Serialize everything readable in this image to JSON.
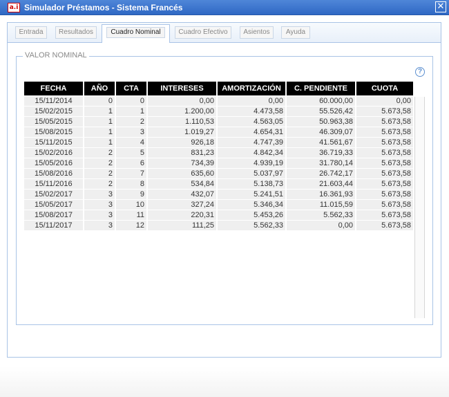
{
  "window": {
    "title": "Simulador Préstamos - Sistema Francés",
    "app_icon_text": "a.i",
    "close_glyph": "✕"
  },
  "tabs": [
    {
      "label": "Entrada"
    },
    {
      "label": "Resultados"
    },
    {
      "label": "Cuadro Nominal"
    },
    {
      "label": "Cuadro Efectivo"
    },
    {
      "label": "Asientos"
    },
    {
      "label": "Ayuda"
    }
  ],
  "active_tab": "Cuadro Nominal",
  "section": {
    "legend": "VALOR NOMINAL",
    "help_glyph": "?"
  },
  "table": {
    "headers": [
      "FECHA",
      "AÑO",
      "CTA",
      "INTERESES",
      "AMORTIZACIÓN",
      "C. PENDIENTE",
      "CUOTA"
    ],
    "rows": [
      [
        "15/11/2014",
        "0",
        "0",
        "0,00",
        "0,00",
        "60.000,00",
        "0,00"
      ],
      [
        "15/02/2015",
        "1",
        "1",
        "1.200,00",
        "4.473,58",
        "55.526,42",
        "5.673,58"
      ],
      [
        "15/05/2015",
        "1",
        "2",
        "1.110,53",
        "4.563,05",
        "50.963,38",
        "5.673,58"
      ],
      [
        "15/08/2015",
        "1",
        "3",
        "1.019,27",
        "4.654,31",
        "46.309,07",
        "5.673,58"
      ],
      [
        "15/11/2015",
        "1",
        "4",
        "926,18",
        "4.747,39",
        "41.561,67",
        "5.673,58"
      ],
      [
        "15/02/2016",
        "2",
        "5",
        "831,23",
        "4.842,34",
        "36.719,33",
        "5.673,58"
      ],
      [
        "15/05/2016",
        "2",
        "6",
        "734,39",
        "4.939,19",
        "31.780,14",
        "5.673,58"
      ],
      [
        "15/08/2016",
        "2",
        "7",
        "635,60",
        "5.037,97",
        "26.742,17",
        "5.673,58"
      ],
      [
        "15/11/2016",
        "2",
        "8",
        "534,84",
        "5.138,73",
        "21.603,44",
        "5.673,58"
      ],
      [
        "15/02/2017",
        "3",
        "9",
        "432,07",
        "5.241,51",
        "16.361,93",
        "5.673,58"
      ],
      [
        "15/05/2017",
        "3",
        "10",
        "327,24",
        "5.346,34",
        "11.015,59",
        "5.673,58"
      ],
      [
        "15/08/2017",
        "3",
        "11",
        "220,31",
        "5.453,26",
        "5.562,33",
        "5.673,58"
      ],
      [
        "15/11/2017",
        "3",
        "12",
        "111,25",
        "5.562,33",
        "0,00",
        "5.673,58"
      ]
    ]
  }
}
